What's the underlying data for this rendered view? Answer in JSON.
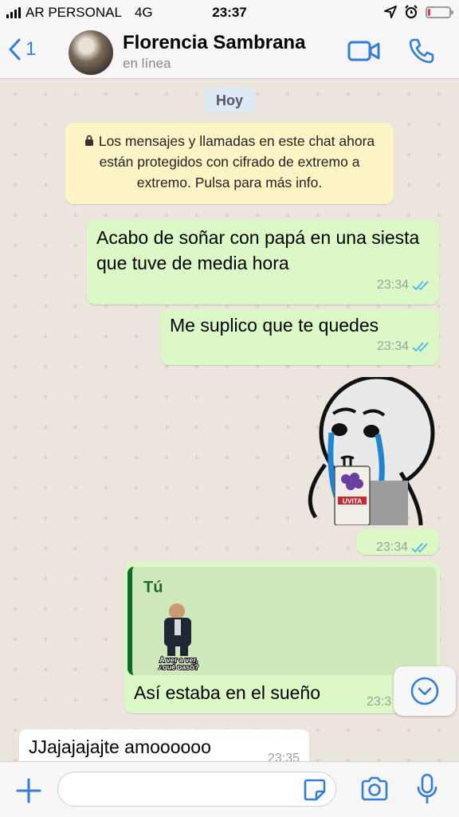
{
  "status_bar": {
    "carrier": "AR PERSONAL",
    "network": "4G",
    "time": "23:37",
    "battery_level": 0.12
  },
  "header": {
    "back_count": "1",
    "contact_name": "Florencia Sambrana",
    "contact_status": "en línea",
    "icons": [
      "back-chevron-icon",
      "video-call-icon",
      "phone-call-icon"
    ]
  },
  "chat": {
    "date_label": "Hoy",
    "encryption_notice": "Los mensajes y llamadas en este chat ahora están protegidos con cifrado de extremo a extremo. Pulsa para más info.",
    "messages": [
      {
        "direction": "out",
        "text": "Acabo de soñar con papá en una siesta que tuve de media hora",
        "time": "23:34",
        "status": "read"
      },
      {
        "direction": "out",
        "text": "Me suplico que te quedes",
        "time": "23:34",
        "status": "read"
      },
      {
        "direction": "out",
        "type": "sticker",
        "sticker_text": "UVITA",
        "time": "23:34",
        "status": "read"
      },
      {
        "direction": "out",
        "quote_author": "Tú",
        "quote_caption_line1": "A ver a ver,",
        "quote_caption_line2": "¿qué pasó?",
        "text": "Así estaba en el sueño",
        "time": "23:3"
      },
      {
        "direction": "in",
        "text": "JJajajajajte amoooooo",
        "time": "23:35"
      }
    ]
  },
  "input_bar": {
    "placeholder": "",
    "icons": [
      "plus-icon",
      "sticker-icon",
      "camera-icon",
      "microphone-icon"
    ]
  },
  "colors": {
    "accent": "#2f7de1",
    "outgoing_bubble": "#dcf8c6",
    "incoming_bubble": "#ffffff",
    "notice_bg": "#fcf4c4",
    "chat_bg": "#ece5dd",
    "read_ticks": "#4fb6ec"
  }
}
